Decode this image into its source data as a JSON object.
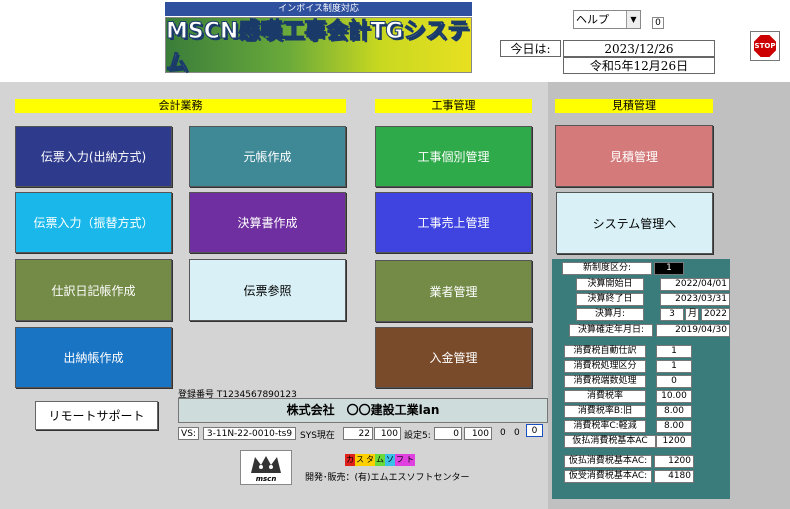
{
  "header": {
    "info_bar": "インボイス制度対応",
    "logo_text": "MSCN感嘆工事会計TGシステム",
    "help_select": "ヘルプ",
    "help_badge": "0",
    "today_label": "今日は:",
    "date_western": "2023/12/26",
    "date_japanese": "令和5年12月26日",
    "stop_label": "STOP"
  },
  "sections": {
    "accounting": "会計業務",
    "construction": "工事管理",
    "estimate": "見積管理"
  },
  "buttons": {
    "slip_cash": "伝票入力(出納方式)",
    "ledger": "元帳作成",
    "const_individual": "工事個別管理",
    "estimate_mgmt": "見積管理",
    "slip_transfer": "伝票入力（振替方式）",
    "financial_docs": "決算書作成",
    "const_sales": "工事売上管理",
    "system_mgmt": "システム管理へ",
    "journal": "仕訳日記帳作成",
    "slip_ref": "伝票参照",
    "vendor_mgmt": "業者管理",
    "cashbook": "出納帳作成",
    "deposit_mgmt": "入金管理",
    "remote_support": "リモートサポート"
  },
  "company": {
    "reg_number": "登録番号 T1234567890123",
    "name": "株式会社　〇〇建設工業lan",
    "vs_label": "VS:",
    "version": "3-11N-22-0010-ts9",
    "sys_label": "SYS現在",
    "sys_v1": "22",
    "sys_v2": "100",
    "setting_label": "設定5:",
    "setting_v1": "0",
    "setting_v2": "100",
    "setting_v3": "0",
    "setting_v4": "0",
    "setting_v5": "0"
  },
  "footer": {
    "brand_strip": [
      "カ",
      "ス",
      "タ",
      "ム",
      "ソ",
      "フ",
      "ト"
    ],
    "developer": "開発･販売：(有)エムエスソフトセンター",
    "mscn_logo": "mscn"
  },
  "info": {
    "new_system_label": "新制度区分:",
    "new_system_value": "1",
    "fiscal_start_label": "決算開始日",
    "fiscal_start_value": "2022/04/01",
    "fiscal_end_label": "決算終了日",
    "fiscal_end_value": "2023/03/31",
    "fiscal_month_label": "決算月:",
    "fiscal_month_value": "3",
    "fiscal_month_unit": "月",
    "fiscal_year_value": "2022",
    "fiscal_confirm_label": "決算確定年月日:",
    "fiscal_confirm_value": "2019/04/30",
    "tax_auto_label": "消費税自動仕訳",
    "tax_auto_value": "1",
    "tax_process_label": "消費税処理区分",
    "tax_process_value": "1",
    "tax_round_label": "消費税端数処理",
    "tax_round_value": "0",
    "tax_rate_label": "消費税率",
    "tax_rate_value": "10.00",
    "tax_rate_b_label": "消費税率B:旧",
    "tax_rate_b_value": "8.00",
    "tax_rate_c_label": "消費税率C:軽減",
    "tax_rate_c_value": "8.00",
    "tax_refund_label": "仮払消費税基本AC",
    "tax_refund_value": "1200",
    "temp_pay_label": "仮払消費税基本AC:",
    "temp_pay_value": "1200",
    "temp_recv_label": "仮受消費税基本AC:",
    "temp_recv_value": "4180"
  },
  "colors": {
    "navy": "#2e3a8c",
    "teal": "#3f8896",
    "green": "#2faa4a",
    "salmon": "#d47a7a",
    "cyan": "#1ab8ea",
    "purple": "#6f2fa0",
    "blue": "#3f44e0",
    "lightcyan": "#d8f0f6",
    "olive": "#748b48",
    "brown": "#7a4b2a",
    "deepblue": "#1a74c4"
  }
}
